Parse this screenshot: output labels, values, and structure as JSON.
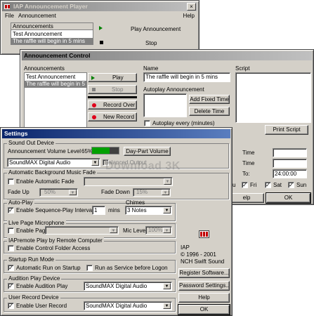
{
  "player": {
    "title": "IAP Announcement Player",
    "menu_file": "File",
    "menu_announcement": "Announcement",
    "menu_help": "Help",
    "list_header": "Announcements",
    "items": [
      "Test Announcement",
      "The raffle will begin in 5 mins"
    ],
    "play_label": "Play Announcement",
    "stop_label": "Stop"
  },
  "control": {
    "title": "Announcement Control",
    "announcements_label": "Announcements",
    "items": [
      "Test Announcement",
      "The raffle will begin in 5 mins"
    ],
    "play": "Play",
    "stop": "Stop",
    "record_over": "Record Over",
    "new_record": "New Record",
    "name_label": "Name",
    "name_value": "The raffle will begin in 5 mins",
    "autoplay_label": "Autoplay Announcement",
    "add_fixed_time": "Add Fixed Time",
    "delete_time": "Delete Time",
    "autoplay_every": "Autoplay every (minutes)",
    "script_label": "Script",
    "print_script": "Print Script",
    "time_label_1": "Time",
    "time_label_2": "Time",
    "to_label": "To:",
    "to_value": "24:00:00",
    "days": [
      {
        "label": "u",
        "checked": true
      },
      {
        "label": "Fri",
        "checked": true
      },
      {
        "label": "Sat",
        "checked": true
      },
      {
        "label": "Sun",
        "checked": true
      }
    ],
    "help": "elp",
    "ok": "OK"
  },
  "settings": {
    "title": "Settings",
    "sound_out": {
      "label": "Sound Out Device",
      "volume_label": "Announcement Volume Level",
      "volume_text": "65%",
      "volume_level": 0.65,
      "daypart_button": "Day-Part Volume",
      "device": "SoundMAX Digital Audio",
      "balanced": "Balanced Output"
    },
    "bg_fade": {
      "label": "Automatic Background Music Fade",
      "enable": "Enable Automatic Fade",
      "fade_up": "Fade Up",
      "fade_up_value": "50%",
      "fade_down": "Fade Down",
      "fade_down_value": "15%"
    },
    "autoplay": {
      "label": "Auto-Play",
      "enable": "Enable Sequence-Play Interval",
      "interval": "1",
      "mins": "mins",
      "chimes_label": "Chimes",
      "chimes_value": "3 Notes"
    },
    "mic": {
      "label": "Live Page Microphone",
      "enable": "Enable Page",
      "mic_level": "Mic Level",
      "mic_level_value": "100%"
    },
    "remote": {
      "label": "IAPremote Play by Remote Computer",
      "enable": "Enable Control Folder Access"
    },
    "startup": {
      "label": "Startup Run Mode",
      "auto_run": "Automatic Run on Startup",
      "service": "Run as Service before Logon"
    },
    "audition": {
      "label": "Audition Play Device",
      "enable": "Enable Audition Play",
      "device": "SoundMAX Digital Audio"
    },
    "user_record": {
      "label": "User Record Device",
      "enable": "Enable User Record",
      "device": "SoundMAX Digital Audio"
    },
    "about": {
      "name": "IAP",
      "copyright": "© 1996 - 2001",
      "company": "NCH Swift Sound"
    },
    "register": "Register Software...",
    "password": "Password Settings...",
    "help": "Help",
    "ok": "OK"
  },
  "watermark": "Download 3K",
  "colors": {
    "active_title": "#0a246a",
    "inactive_title": "#808080",
    "record_dot": "#e0001b",
    "volume_fill": "#00a000",
    "play_arrow": "#008000"
  }
}
